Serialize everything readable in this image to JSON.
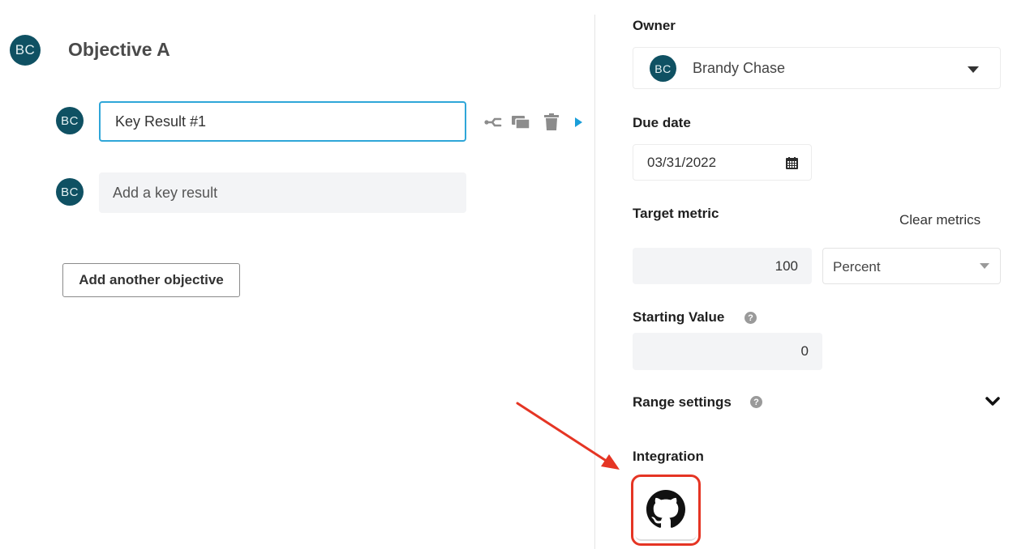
{
  "objective": {
    "avatar_initials": "BC",
    "title": "Objective A"
  },
  "key_results": [
    {
      "avatar_initials": "BC",
      "value": "Key Result #1"
    },
    {
      "avatar_initials": "BC",
      "placeholder": "Add a key result"
    }
  ],
  "add_objective_label": "Add another objective",
  "details": {
    "owner_label": "Owner",
    "owner": {
      "initials": "BC",
      "name": "Brandy Chase"
    },
    "due_date_label": "Due date",
    "due_date": "03/31/2022",
    "target_metric_label": "Target metric",
    "clear_metrics_label": "Clear metrics",
    "target_value": "100",
    "unit": "Percent",
    "starting_value_label": "Starting Value",
    "starting_value": "0",
    "range_settings_label": "Range settings",
    "integration_label": "Integration",
    "help_glyph": "?"
  },
  "icons": {
    "kr_actions": [
      "branch-icon",
      "duplicate-icon",
      "trash-icon",
      "play-icon"
    ],
    "integration": "github-icon",
    "calendar": "calendar-icon"
  },
  "colors": {
    "avatar_bg": "#0f5163",
    "focus_border": "#2fa6d8",
    "accent_play": "#1a9ed9",
    "highlight_red": "#e53524"
  }
}
